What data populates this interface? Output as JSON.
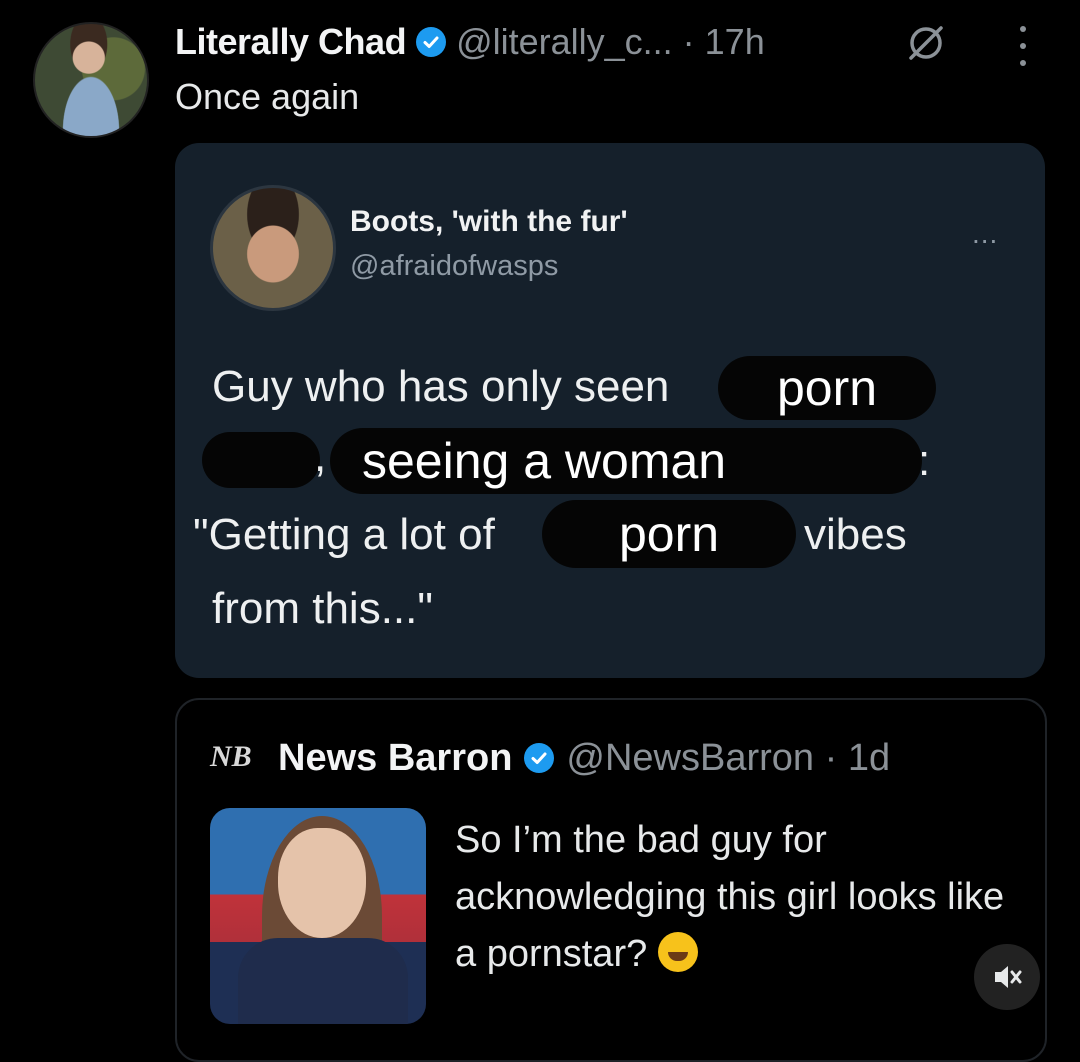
{
  "outer_tweet": {
    "display_name": "Literally Chad",
    "handle": "@literally_c...",
    "time": "· 17h",
    "text": "Once again",
    "icons": [
      "verified-badge-icon",
      "grok-icon",
      "more-options-icon"
    ]
  },
  "embedded_card": {
    "display_name": "Boots, 'with the fur'",
    "handle": "@afraidofwasps",
    "more": "...",
    "lines": {
      "l1_prefix": "Guy who has only seen",
      "l1_redact": "porn",
      "l2_comma": ",",
      "l2_redact": "seeing a woman",
      "l2_colon": ":",
      "l3_prefix": "\"Getting a lot of",
      "l3_redact": "porn",
      "l3_suffix": "vibes",
      "l4": "from this...\""
    }
  },
  "quoted_tweet": {
    "logo": "NB",
    "display_name": "News Barron",
    "handle": "@NewsBarron · 1d",
    "text": "So I’m the bad guy for acknowledging this girl looks like a pornstar?",
    "icons": [
      "rofl-emoji-icon",
      "muted-speaker-icon"
    ]
  },
  "colors": {
    "background": "#000000",
    "card": "#15202b",
    "verified": "#1d9bf0",
    "muted_text": "#8b9197"
  }
}
